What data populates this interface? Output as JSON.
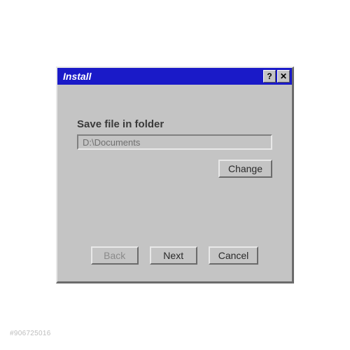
{
  "window": {
    "title": "Install"
  },
  "titlebar": {
    "help_symbol": "?",
    "close_symbol": "✕"
  },
  "content": {
    "label": "Save file in folder",
    "path_value": "D:\\Documents"
  },
  "buttons": {
    "change": "Change",
    "back": "Back",
    "next": "Next",
    "cancel": "Cancel"
  },
  "watermark": "#906725016"
}
